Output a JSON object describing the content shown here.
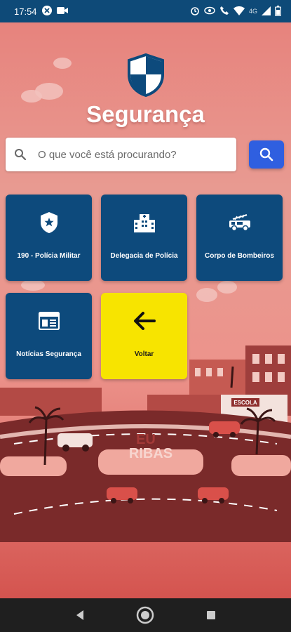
{
  "status_bar": {
    "time": "17:54",
    "left_icons": [
      "app-x-icon",
      "camera-icon"
    ],
    "network_label": "4G",
    "right_icons": [
      "alarm-icon",
      "eye-icon",
      "call-icon",
      "wifi-icon",
      "signal-icon",
      "battery-icon"
    ]
  },
  "header": {
    "title": "Segurança",
    "logo": "shield-icon"
  },
  "search": {
    "placeholder": "O que você está procurando?",
    "value": ""
  },
  "tiles": [
    {
      "label": "190 - Polícia Militar",
      "icon": "police-badge-icon"
    },
    {
      "label": "Delegacia de Polícia",
      "icon": "building-icon"
    },
    {
      "label": "Corpo de Bombeiros",
      "icon": "fire-truck-icon"
    },
    {
      "label": "Notícias Segurança",
      "icon": "news-icon"
    },
    {
      "label": "Voltar",
      "icon": "back-arrow-icon"
    }
  ],
  "illustration": {
    "sign_text": "EU\nRIBAS",
    "building_sign": "ESCOLA"
  },
  "colors": {
    "status_bar": "#0e4a78",
    "tile": "#0d4a7c",
    "back_tile": "#f7e400",
    "search_button": "#2f5fe0"
  }
}
